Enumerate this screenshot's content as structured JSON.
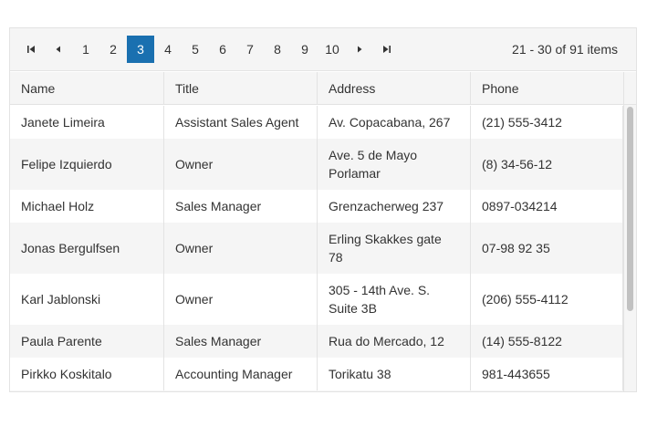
{
  "pager": {
    "pages": [
      "1",
      "2",
      "3",
      "4",
      "5",
      "6",
      "7",
      "8",
      "9",
      "10"
    ],
    "current_page": "3",
    "info": "21 - 30 of 91 items"
  },
  "columns": [
    "Name",
    "Title",
    "Address",
    "Phone"
  ],
  "rows": [
    [
      "Janete Limeira",
      "Assistant Sales Agent",
      "Av. Copacabana, 267",
      "(21) 555-3412"
    ],
    [
      "Felipe Izquierdo",
      "Owner",
      "Ave. 5 de Mayo Porlamar",
      "(8) 34-56-12"
    ],
    [
      "Michael Holz",
      "Sales Manager",
      "Grenzacherweg 237",
      "0897-034214"
    ],
    [
      "Jonas Bergulfsen",
      "Owner",
      "Erling Skakkes gate 78",
      "07-98 92 35"
    ],
    [
      "Karl Jablonski",
      "Owner",
      "305 - 14th Ave. S. Suite 3B",
      "(206) 555-4112"
    ],
    [
      "Paula Parente",
      "Sales Manager",
      "Rua do Mercado, 12",
      "(14) 555-8122"
    ],
    [
      "Pirkko Koskitalo",
      "Accounting Manager",
      "Torikatu 38",
      "981-443655"
    ]
  ]
}
